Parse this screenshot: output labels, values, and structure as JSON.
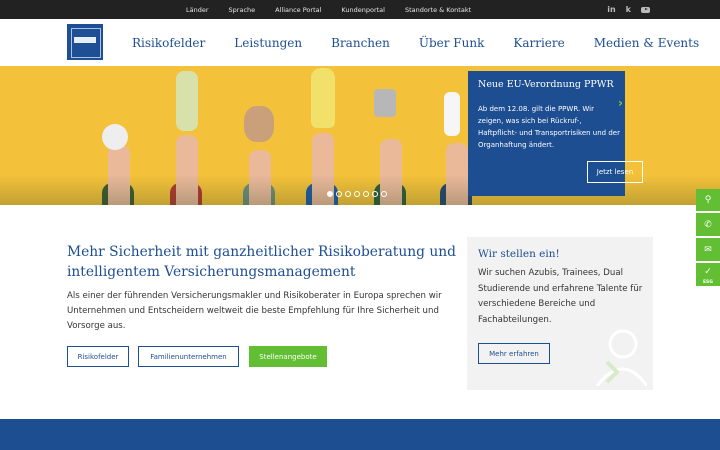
{
  "topbar": {
    "links": [
      "Länder",
      "Sprache",
      "Alliance Portal",
      "Kundenportal",
      "Standorte & Kontakt"
    ],
    "social": [
      "linkedin-icon",
      "kununu-icon",
      "youtube-icon"
    ],
    "social_glyphs": {
      "linkedin": "in",
      "kununu": "k"
    }
  },
  "nav": {
    "logo": "funk-logo",
    "items": [
      "Risikofelder",
      "Leistungen",
      "Branchen",
      "Über Funk",
      "Karriere",
      "Medien & Events"
    ]
  },
  "hero": {
    "card_title": "Neue EU-Verordnung PPWR",
    "card_text": "Ab dem 12.08. gilt die PPWR. Wir zeigen, was sich bei Rückruf-, Haftpflicht- und Transportrisiken und der Organhaftung ändert.",
    "card_button": "Jetzt lesen",
    "slides_total": 7,
    "slide_active": 1
  },
  "sidebar_icons": [
    "search-icon",
    "phone-icon",
    "mail-icon",
    "esg-icon"
  ],
  "sidebar_esg_label": "ESG",
  "main": {
    "headline": "Mehr Sicherheit mit ganzheitlicher Risikoberatung und intelligentem Versicherungsmanagement",
    "intro": "Als einer der führenden Versicherungsmakler und Risikoberater in Europa spre­chen wir Unternehmen und Entscheidern weltweit die beste Empfehlung für Ihre Sicherheit und Vorsorge aus.",
    "buttons": [
      "Risikofelder",
      "Familienunternehmen",
      "Stellenangebote"
    ]
  },
  "jobs": {
    "title": "Wir stellen ein!",
    "text": "Wir suchen Azubis, Trainees, Dual Studierende und erfahrene Talente für verschiedene Bereiche und Fachabteilungen.",
    "button": "Mehr erfahren"
  },
  "colors": {
    "brand_blue": "#1d4e92",
    "accent_green": "#62bf34",
    "hero_yellow": "#f4c23a",
    "topbar": "#222222"
  }
}
